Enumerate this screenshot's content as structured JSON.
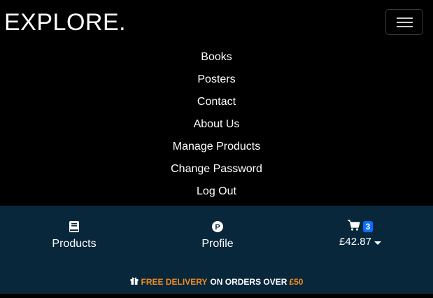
{
  "header": {
    "brand": "EXPLORE."
  },
  "nav": {
    "items": [
      {
        "label": "Books"
      },
      {
        "label": "Posters"
      },
      {
        "label": "Contact"
      },
      {
        "label": "About Us"
      },
      {
        "label": "Manage Products"
      },
      {
        "label": "Change Password"
      },
      {
        "label": "Log Out"
      }
    ]
  },
  "bottom_bar": {
    "products_label": "Products",
    "products_icon": "book-icon",
    "profile_label": "Profile",
    "profile_icon": "profile-p-icon",
    "cart_icon": "shopping-cart-icon",
    "cart_count": "3",
    "cart_total": "£42.87",
    "background_color": "#08273b",
    "badge_color": "#0d6efd"
  },
  "promo": {
    "icon": "gift-icon",
    "highlight": "FREE DELIVERY",
    "middle": "ON ORDERS OVER",
    "amount": "£50",
    "accent_color": "#f08a24"
  }
}
